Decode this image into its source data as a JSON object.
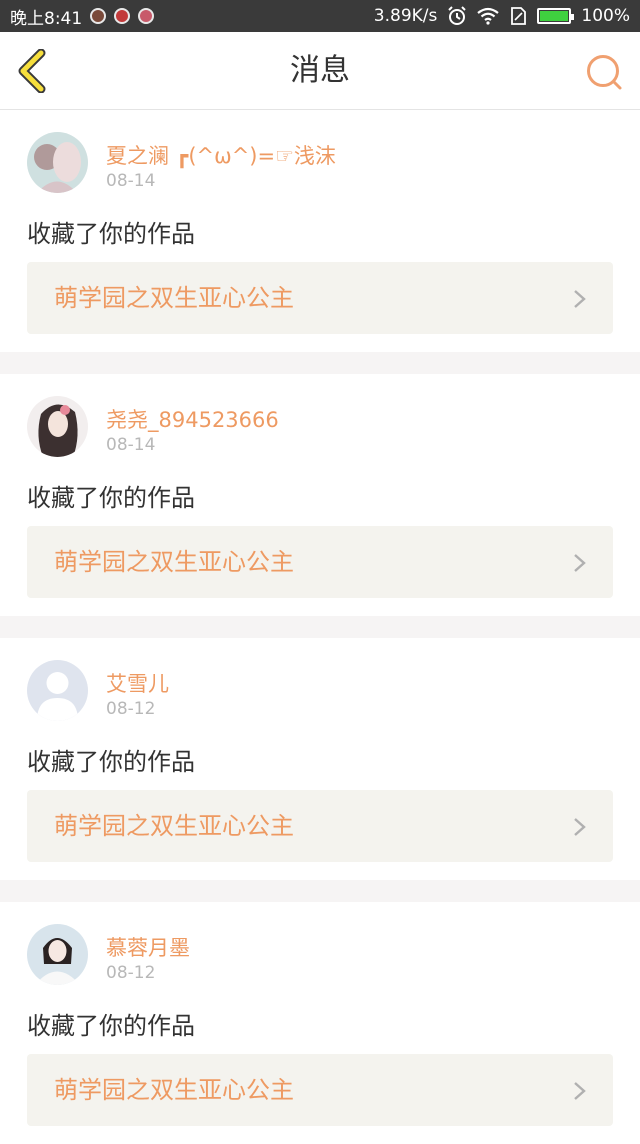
{
  "status_bar": {
    "time": "晚上8:41",
    "network_speed": "3.89K/s",
    "battery_percent": "100%",
    "battery_level": 1.0
  },
  "header": {
    "title": "消息",
    "back_icon": "chevron-left-icon",
    "search_icon": "search-icon",
    "accent_color": "#f0a070"
  },
  "messages": [
    {
      "user": "夏之澜 ┏(^ω^)=☞浅沫",
      "date": "08-14",
      "action": "收藏了你的作品",
      "work_title": "萌学园之双生亚心公主"
    },
    {
      "user": "尧尧_894523666",
      "date": "08-14",
      "action": "收藏了你的作品",
      "work_title": "萌学园之双生亚心公主"
    },
    {
      "user": "艾雪儿",
      "date": "08-12",
      "action": "收藏了你的作品",
      "work_title": "萌学园之双生亚心公主"
    },
    {
      "user": "慕蓉月墨",
      "date": "08-12",
      "action": "收藏了你的作品",
      "work_title": "萌学园之双生亚心公主"
    }
  ],
  "colors": {
    "name": "#ee9a62",
    "date": "#b8b8b8",
    "link_bg": "#f4f3ee",
    "separator": "#f6f4f4"
  }
}
